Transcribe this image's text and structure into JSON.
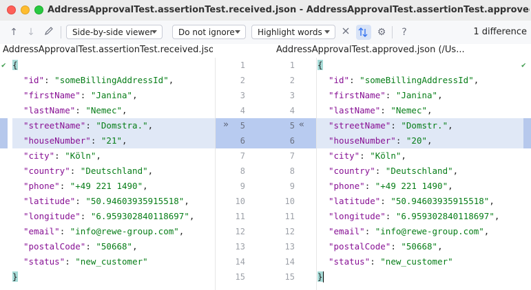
{
  "window": {
    "title": "AddressApprovalTest.assertionTest.received.json - AddressApprovalTest.assertionTest.approved.json (/Use..."
  },
  "toolbar": {
    "viewer": "Side-by-side viewer",
    "ignore": "Do not ignore",
    "highlight": "Highlight words",
    "diff_count": "1 difference",
    "icons": [
      "arrow-up-icon",
      "arrow-down-icon",
      "pencil-icon",
      "close-icon",
      "sync-scroll-icon",
      "gear-icon",
      "help-icon"
    ]
  },
  "panes": {
    "left_header": "AddressApprovalTest.assertionTest.received.json (/Us...",
    "right_header": "AddressApprovalTest.approved.json (/Us..."
  },
  "left_lines": [
    {
      "k": "",
      "v": "{"
    },
    {
      "k": "\"id\"",
      "v": "\"someBillingAddressId\","
    },
    {
      "k": "\"firstName\"",
      "v": "\"Janina\","
    },
    {
      "k": "\"lastName\"",
      "v": "\"Nemec\","
    },
    {
      "k": "\"streetName\"",
      "v": "\"Domstra.\","
    },
    {
      "k": "\"houseNumber\"",
      "v": "\"21\","
    },
    {
      "k": "\"city\"",
      "v": "\"Köln\","
    },
    {
      "k": "\"country\"",
      "v": "\"Deutschland\","
    },
    {
      "k": "\"phone\"",
      "v": "\"+49 221 1490\","
    },
    {
      "k": "\"latitude\"",
      "v": "\"50.94603935915518\","
    },
    {
      "k": "\"longitude\"",
      "v": "\"6.959302840118697\","
    },
    {
      "k": "\"email\"",
      "v": "\"info@rewe-group.com\","
    },
    {
      "k": "\"postalCode\"",
      "v": "\"50668\","
    },
    {
      "k": "\"status\"",
      "v": "\"new_customer\""
    },
    {
      "k": "",
      "v": "}"
    }
  ],
  "right_lines": [
    {
      "k": "",
      "v": "{"
    },
    {
      "k": "\"id\"",
      "v": "\"someBillingAddressId\","
    },
    {
      "k": "\"firstName\"",
      "v": "\"Janina\","
    },
    {
      "k": "\"lastName\"",
      "v": "\"Nemec\","
    },
    {
      "k": "\"streetName\"",
      "v": "\"Domstr.\","
    },
    {
      "k": "\"houseNumber\"",
      "v": "\"20\","
    },
    {
      "k": "\"city\"",
      "v": "\"Köln\","
    },
    {
      "k": "\"country\"",
      "v": "\"Deutschland\","
    },
    {
      "k": "\"phone\"",
      "v": "\"+49 221 1490\","
    },
    {
      "k": "\"latitude\"",
      "v": "\"50.94603935915518\","
    },
    {
      "k": "\"longitude\"",
      "v": "\"6.959302840118697\","
    },
    {
      "k": "\"email\"",
      "v": "\"info@rewe-group.com\","
    },
    {
      "k": "\"postalCode\"",
      "v": "\"50668\","
    },
    {
      "k": "\"status\"",
      "v": "\"new_customer\""
    },
    {
      "k": "",
      "v": "}"
    }
  ],
  "line_numbers": [
    "1",
    "2",
    "3",
    "4",
    "5",
    "6",
    "7",
    "8",
    "9",
    "10",
    "11",
    "12",
    "13",
    "14",
    "15"
  ],
  "changed_lines": [
    5,
    6
  ],
  "colors": {
    "key": "#871094",
    "string": "#067d17",
    "change_bg": "#e0e8f6",
    "gutter_change": "#b8cbf0"
  }
}
